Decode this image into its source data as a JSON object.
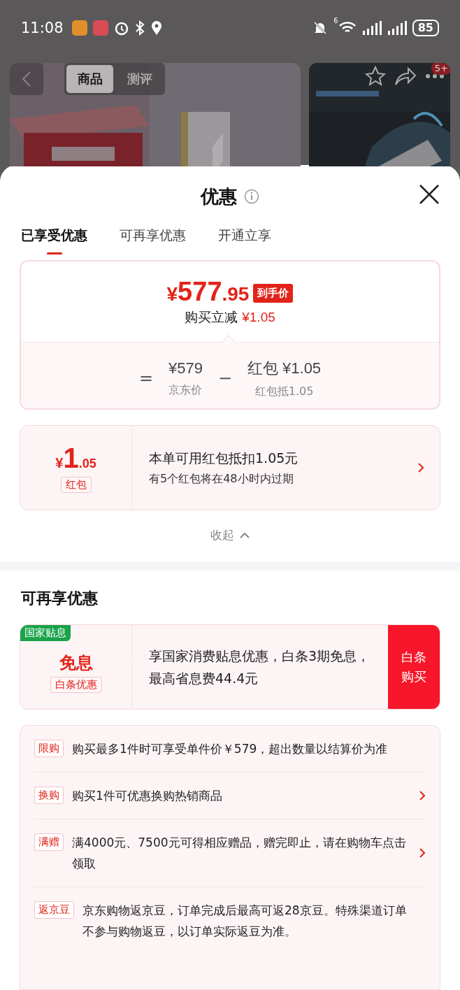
{
  "status_bar": {
    "time": "11:08",
    "wifi_generation": "6",
    "battery": "85"
  },
  "product_header": {
    "tabs": [
      {
        "label": "商品",
        "selected": true
      },
      {
        "label": "测评",
        "selected": false
      }
    ],
    "gallery_badge": "5+"
  },
  "sheet": {
    "title": "优惠",
    "tabs": [
      {
        "label": "已享受优惠",
        "selected": true
      },
      {
        "label": "可再享优惠",
        "selected": false
      },
      {
        "label": "开通立享",
        "selected": false
      }
    ],
    "price_card": {
      "currency": "¥",
      "price_integer": "577",
      "price_decimal": ".95",
      "price_tag": "到手价",
      "reduction_label": "购买立减",
      "reduction_value": "¥1.05",
      "equals": "=",
      "jd_price": "¥579",
      "jd_price_label": "京东价",
      "minus": "−",
      "coupon_name": "红包",
      "coupon_value": "¥1.05",
      "coupon_label": "红包抵1.05"
    },
    "coupon_card": {
      "currency": "¥",
      "amount_integer": "1",
      "amount_decimal": ".05",
      "tag": "红包",
      "line_1": "本单可用红包抵扣1.05元",
      "line_2": "有5个红包将在48小时内过期"
    },
    "collapse_label": "收起",
    "more_section": {
      "title": "可再享优惠",
      "subsidy_card": {
        "corner_tag": "国家贴息",
        "title": "免息",
        "tag": "白条优惠",
        "text": "享国家消费贴息优惠，白条3期免息，最高省息费44.4元",
        "button": "白条购买"
      },
      "promotions": [
        {
          "tag": "限购",
          "text": "购买最多1件时可享受单件价￥579，超出数量以结算价为准",
          "arrow": false
        },
        {
          "tag": "换购",
          "text": "购买1件可优惠换购热销商品",
          "arrow": true
        },
        {
          "tag": "满赠",
          "text": "满4000元、7500元可得相应赠品，赠完即止，请在购物车点击领取",
          "arrow": true
        },
        {
          "tag": "返京豆",
          "text": "京东购物返京豆，订单完成后最高可返28京豆。特殊渠道订单不参与购物返豆，以订单实际返豆为准。",
          "arrow": false
        }
      ]
    }
  }
}
